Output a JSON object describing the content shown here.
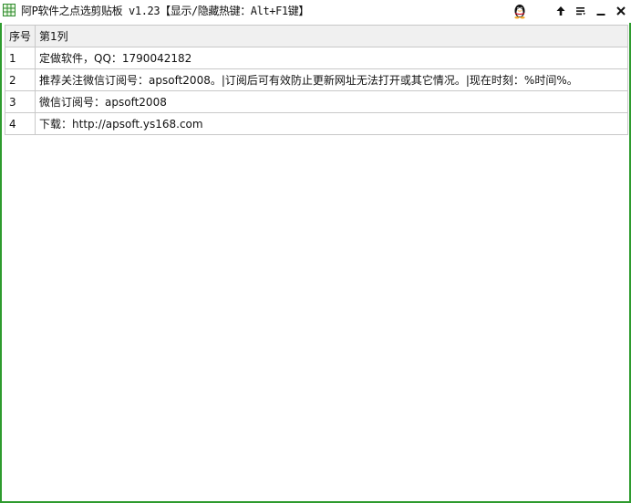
{
  "window": {
    "title": "阿P软件之点选剪贴板 v1.23【显示/隐藏热键：Alt+F1键】"
  },
  "titlebar_buttons": {
    "qq": "qq-penguin-icon",
    "up": "↑",
    "menu": "≡",
    "minimize": "—",
    "close": "✕"
  },
  "table": {
    "columns": [
      "序号",
      "第1列"
    ],
    "rows": [
      {
        "idx": "1",
        "text": "定做软件，QQ：1790042182"
      },
      {
        "idx": "2",
        "text": "推荐关注微信订阅号：apsoft2008。|订阅后可有效防止更新网址无法打开或其它情况。|现在时刻：%时间%。"
      },
      {
        "idx": "3",
        "text": "微信订阅号：apsoft2008"
      },
      {
        "idx": "4",
        "text": "下载：http://apsoft.ys168.com"
      }
    ]
  },
  "colors": {
    "accent_green": "#2e9b2e",
    "grid_line": "#c8c8c8",
    "header_bg": "#f0f0f0"
  }
}
